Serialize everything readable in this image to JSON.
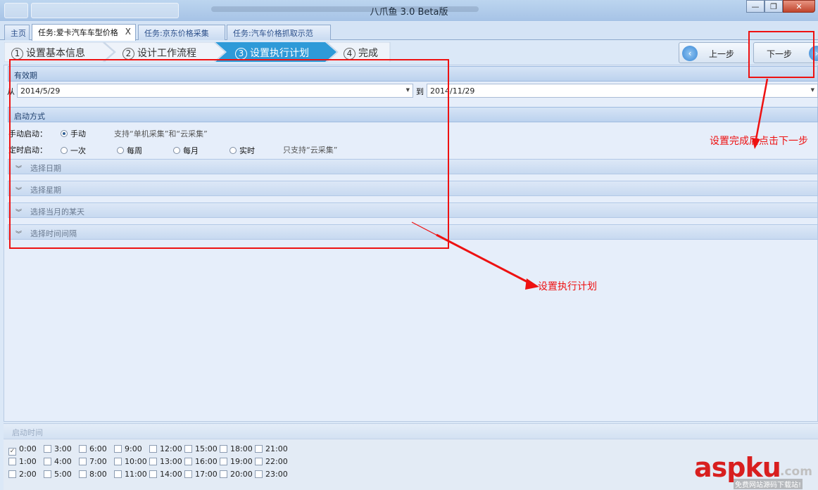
{
  "window": {
    "title": "八爪鱼 3.0 Beta版"
  },
  "tabs": [
    {
      "label": "主页"
    },
    {
      "label": "任务:爱卡汽车车型价格"
    },
    {
      "label": "任务:京东价格采集"
    },
    {
      "label": "任务:汽车价格抓取示范"
    }
  ],
  "close_glyph": "X",
  "steps": [
    {
      "num": "1",
      "label": "设置基本信息"
    },
    {
      "num": "2",
      "label": "设计工作流程"
    },
    {
      "num": "3",
      "label": "设置执行计划"
    },
    {
      "num": "4",
      "label": "完成"
    }
  ],
  "nav": {
    "prev_label": "上一步",
    "next_label": "下一步"
  },
  "validity": {
    "title": "有效期",
    "from_label": "从",
    "from_value": "2014/5/29",
    "to_label": "到",
    "to_value": "2014/11/29"
  },
  "launch": {
    "title": "启动方式",
    "manual_label": "手动启动：",
    "manual_option": "手动",
    "manual_hint": "支持“单机采集”和“云采集”",
    "timed_label": "定时启动：",
    "timed_options": [
      "一次",
      "每周",
      "每月",
      "实时"
    ],
    "timed_hint": "只支持“云采集”"
  },
  "collapsibles": [
    "选择日期",
    "选择星期",
    "选择当月的某天",
    "选择时间间隔"
  ],
  "start_time": {
    "title": "启动时间",
    "times": [
      [
        "0:00",
        "3:00",
        "6:00",
        "9:00",
        "12:00",
        "15:00",
        "18:00",
        "21:00"
      ],
      [
        "1:00",
        "4:00",
        "7:00",
        "10:00",
        "13:00",
        "16:00",
        "19:00",
        "22:00"
      ],
      [
        "2:00",
        "5:00",
        "8:00",
        "11:00",
        "14:00",
        "17:00",
        "20:00",
        "23:00"
      ]
    ],
    "checked": "0:00"
  },
  "annotations": {
    "next_hint": "设置完成后点击下一步",
    "plan_hint": "设置执行计划"
  },
  "watermark": {
    "main": "aspku",
    "suffix": ".com",
    "sub": "免费网站源码下载站!"
  },
  "colors": {
    "accent": "#2e9ad8",
    "annotation": "#ee1111",
    "header_bg": "#bcd2ee"
  }
}
